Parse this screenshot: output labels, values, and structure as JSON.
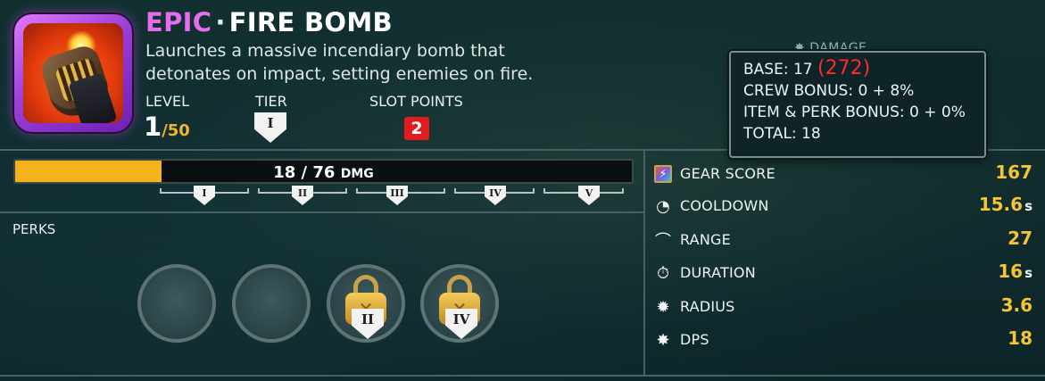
{
  "item": {
    "rarity": "EPIC",
    "separator": "·",
    "name": "FIRE BOMB",
    "description_line1": "Launches a massive incendiary bomb that",
    "description_line2": "detonates on impact, setting enemies on fire.",
    "icon": "fire-bomb-icon",
    "rarity_color": "#e86cf2"
  },
  "info": {
    "level_label": "LEVEL",
    "level_value": "1",
    "level_max": "/50",
    "tier_label": "TIER",
    "tier_value": "I",
    "slot_points_label": "SLOT POINTS",
    "slot_points_value": "2"
  },
  "progress": {
    "current": "18",
    "separator": " / ",
    "max": "76",
    "unit": "DMG",
    "fraction": 0.237,
    "fill_color": "#f6b21c"
  },
  "tiers": [
    "I",
    "II",
    "III",
    "IV",
    "V"
  ],
  "perks": {
    "label": "PERKS",
    "slots": [
      {
        "state": "empty"
      },
      {
        "state": "empty"
      },
      {
        "state": "locked",
        "tier": "II"
      },
      {
        "state": "locked",
        "tier": "IV"
      }
    ]
  },
  "stats": {
    "damage_peek": "DAMAGE",
    "rows": [
      {
        "icon": "gear-score-icon",
        "label": "GEAR SCORE",
        "value": "167",
        "unit": ""
      },
      {
        "icon": "cooldown-icon",
        "label": "COOLDOWN",
        "value": "15.6",
        "unit": "s"
      },
      {
        "icon": "range-icon",
        "label": "RANGE",
        "value": "27",
        "unit": ""
      },
      {
        "icon": "duration-icon",
        "label": "DURATION",
        "value": "16",
        "unit": "s"
      },
      {
        "icon": "radius-icon",
        "label": "RADIUS",
        "value": "3.6",
        "unit": ""
      },
      {
        "icon": "dps-icon",
        "label": "DPS",
        "value": "18",
        "unit": ""
      }
    ],
    "value_color": "#f4c431"
  },
  "tooltip": {
    "base_label": "BASE: 17 ",
    "base_extra": "(272)",
    "crew_bonus": "CREW BONUS: 0 + 8%",
    "item_perk_bonus": "ITEM & PERK BONUS: 0 + 0%",
    "total": "TOTAL: 18",
    "extra_color": "#ff2a2a"
  }
}
